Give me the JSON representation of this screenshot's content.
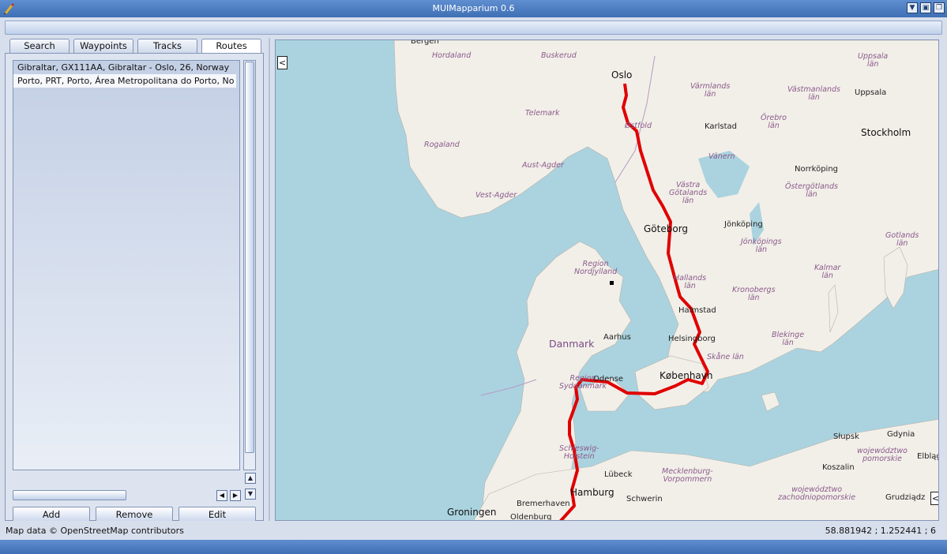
{
  "window": {
    "title": "MUIMapparium 0.6"
  },
  "tabs": [
    {
      "label": "Search"
    },
    {
      "label": "Waypoints"
    },
    {
      "label": "Tracks"
    },
    {
      "label": "Routes"
    }
  ],
  "routes": [
    {
      "label": "Gibraltar, GX111AA, Gibraltar - Oslo, 26, Norway"
    },
    {
      "label": "Porto, PRT, Porto, Área Metropolitana do Porto, No"
    }
  ],
  "buttons": {
    "add": "Add",
    "remove": "Remove",
    "edit": "Edit"
  },
  "status": {
    "attribution": "Map data © OpenStreetMap contributors",
    "coords": "58.881942 ; 1.252441 ; 6"
  },
  "map": {
    "collapse_left": "<",
    "collapse_right": "<",
    "route_color": "#e00000",
    "water_color": "#aad3df",
    "land_color": "#f2efe9",
    "labels": {
      "bergen": "Bergen",
      "hordaland": "Hordaland",
      "buskerud": "Buskerud",
      "oslo": "Oslo",
      "uppsala_lan": "Uppsala\nlän",
      "varmlands_lan": "Värmlands\nlän",
      "vastmanlands_lan": "Västmanlands\nlän",
      "uppsala": "Uppsala",
      "telemark": "Telemark",
      "ostfold": "Østfold",
      "karlstad": "Karlstad",
      "orebro_lan": "Örebro\nlän",
      "stockholm": "Stockholm",
      "rogaland": "Rogaland",
      "aust_agder": "Aust-Agder",
      "vanern": "Vänern",
      "norrkoping": "Norrköping",
      "vest_agder": "Vest-Agder",
      "vastra_gotalands_lan": "Västra\nGötalands\nlän",
      "ostergotlands_lan": "Östergötlands\nlän",
      "jonkoping": "Jönköping",
      "goteborg": "Göteborg",
      "jonkopings_lan": "Jönköpings\nlän",
      "gotlands_lan": "Gotlands\nlän",
      "region_nordjylland": "Region\nNordjylland",
      "hallands_lan": "Hallands\nlän",
      "kalmar_lan": "Kalmar\nlän",
      "kronobergs_lan": "Kronobergs\nlän",
      "halmstad": "Halmstad",
      "danmark": "Danmark",
      "aarhus": "Aarhus",
      "helsingborg": "Helsingborg",
      "blekinge_lan": "Blekinge\nlän",
      "skane_lan": "Skåne län",
      "region_syddanmark": "Region\nSyddanmark",
      "odense": "Odense",
      "kobenhavn": "København",
      "slupsk": "Słupsk",
      "gdynia": "Gdynia",
      "elblag": "Elbląg",
      "schleswig_holstein": "Schleswig-\nHolstein",
      "wojewodztwo_pomorskie": "województwo\npomorskie",
      "koszalin": "Koszalin",
      "lubeck": "Lübeck",
      "mecklenburg": "Mecklenburg-\nVorpommern",
      "wojewodztwo_zach": "województwo\nzachodniopomorskie",
      "hamburg": "Hamburg",
      "schwerin": "Schwerin",
      "grudziadz": "Grudziądz",
      "bremerhaven": "Bremerhaven",
      "groningen": "Groningen",
      "oldenburg": "Oldenburg"
    }
  }
}
